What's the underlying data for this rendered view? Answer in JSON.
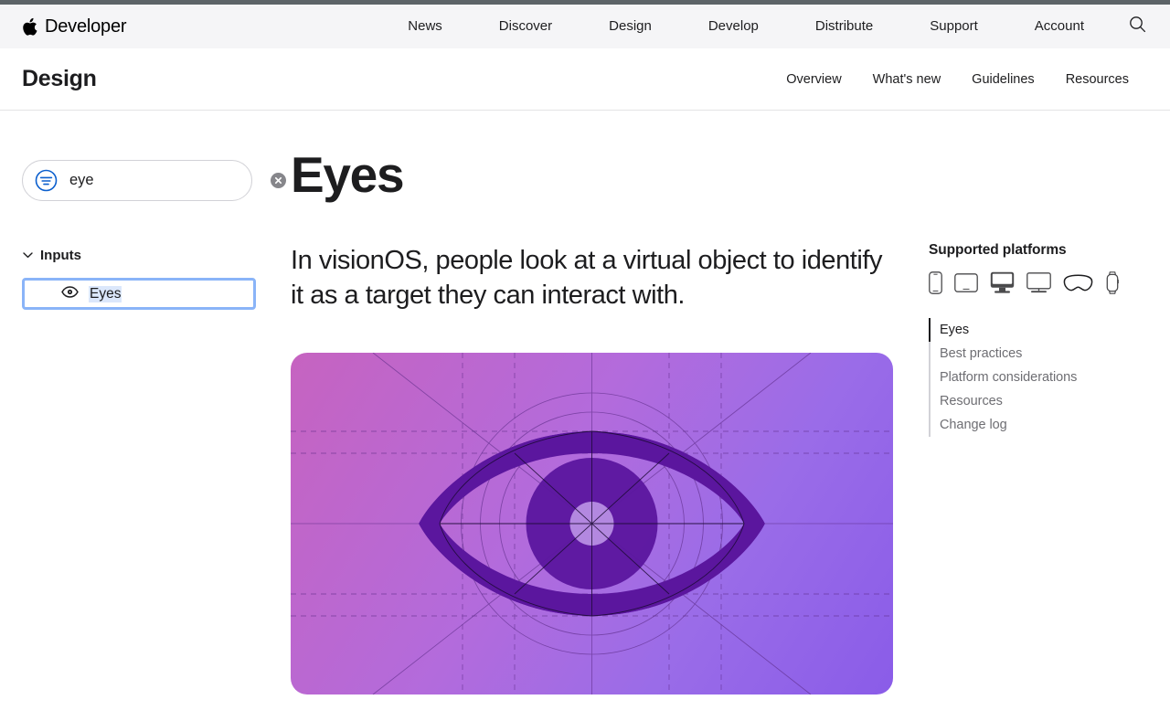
{
  "globalnav": {
    "brand": "Developer",
    "links": [
      "News",
      "Discover",
      "Design",
      "Develop",
      "Distribute",
      "Support",
      "Account"
    ],
    "search_icon": "search-icon"
  },
  "localnav": {
    "title": "Design",
    "links": [
      "Overview",
      "What's new",
      "Guidelines",
      "Resources"
    ]
  },
  "sidebar": {
    "filter": {
      "value": "eye",
      "placeholder": "Filter",
      "icon": "filter-lines-icon",
      "clear_label": "×"
    },
    "group": {
      "label": "Inputs",
      "chevron": "chevron-down-icon",
      "items": [
        {
          "label": "Eyes",
          "icon": "eye-icon",
          "selected": true
        }
      ]
    }
  },
  "main": {
    "title": "Eyes",
    "intro": "In visionOS, people look at a virtual object to identify it as a target they can interact with.",
    "hero": {
      "name": "eyes-hero-illustration",
      "gradient_start": "#c663c0",
      "gradient_end": "#8a5ce8",
      "shape_color": "#5b169e",
      "iris_color": "#6a20b5",
      "guide_color": "#5b2b86"
    }
  },
  "rail": {
    "platforms_title": "Supported platforms",
    "platforms": [
      "iphone-icon",
      "ipad-icon",
      "mac-icon",
      "tv-icon",
      "vision-pro-icon",
      "watch-icon"
    ],
    "toc": [
      {
        "label": "Eyes",
        "active": true
      },
      {
        "label": "Best practices",
        "active": false
      },
      {
        "label": "Platform considerations",
        "active": false
      },
      {
        "label": "Resources",
        "active": false
      },
      {
        "label": "Change log",
        "active": false
      }
    ]
  }
}
